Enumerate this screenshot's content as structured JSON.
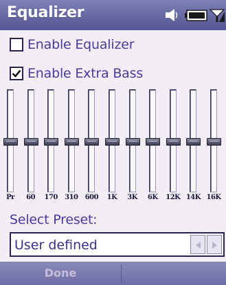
{
  "window": {
    "title": "Equalizer",
    "accent_color": "#6868a4",
    "status_icons": [
      "speaker-icon",
      "battery-icon",
      "signal-icon"
    ]
  },
  "options": {
    "enable_equalizer": {
      "label": "Enable Equalizer",
      "checked": false
    },
    "enable_extra_bass": {
      "label": "Enable Extra Bass",
      "checked": true
    }
  },
  "equalizer": {
    "bands": [
      {
        "label": "Pr",
        "level": 0.5
      },
      {
        "label": "60",
        "level": 0.5
      },
      {
        "label": "170",
        "level": 0.5
      },
      {
        "label": "310",
        "level": 0.5
      },
      {
        "label": "600",
        "level": 0.5
      },
      {
        "label": "1K",
        "level": 0.5
      },
      {
        "label": "3K",
        "level": 0.5
      },
      {
        "label": "6K",
        "level": 0.5
      },
      {
        "label": "12K",
        "level": 0.5
      },
      {
        "label": "14K",
        "level": 0.5
      },
      {
        "label": "16K",
        "level": 0.5
      }
    ]
  },
  "preset": {
    "label": "Select Preset:",
    "selected": "User defined"
  },
  "softkeys": {
    "left": "Done",
    "right": ""
  }
}
